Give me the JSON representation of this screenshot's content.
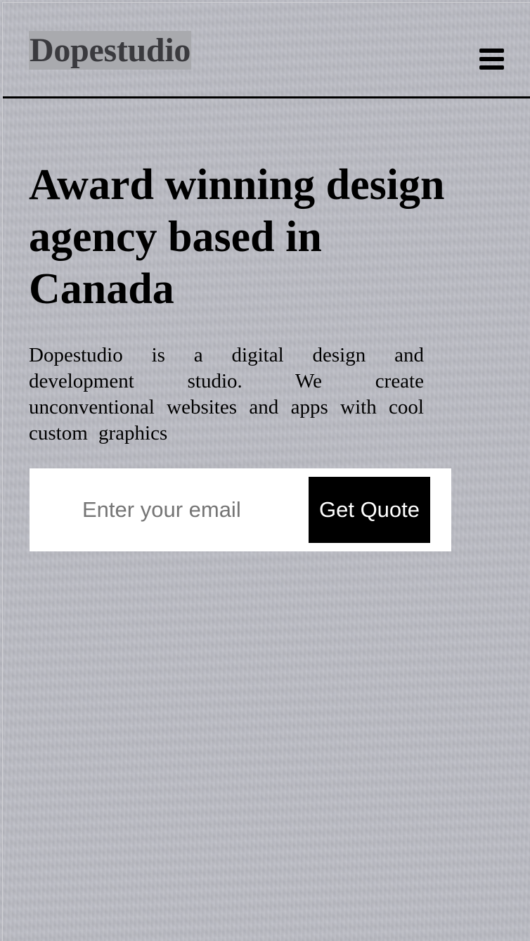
{
  "navbar": {
    "brand": "Dopestudio",
    "menu_icon": "hamburger-menu-icon"
  },
  "hero": {
    "headline": "Award winning design agency based in Canada",
    "lead": "Dopestudio is a digital design and development studio. We create unconventional websites and apps with cool custom graphics"
  },
  "signup": {
    "email_placeholder": "Enter your email",
    "email_value": "",
    "button_label": "Get Quote"
  },
  "colors": {
    "background": "#bbbcc4",
    "brand_highlight": "#a9aaae",
    "button_background": "#000000",
    "button_text": "#ffffff",
    "form_background": "#ffffff"
  }
}
